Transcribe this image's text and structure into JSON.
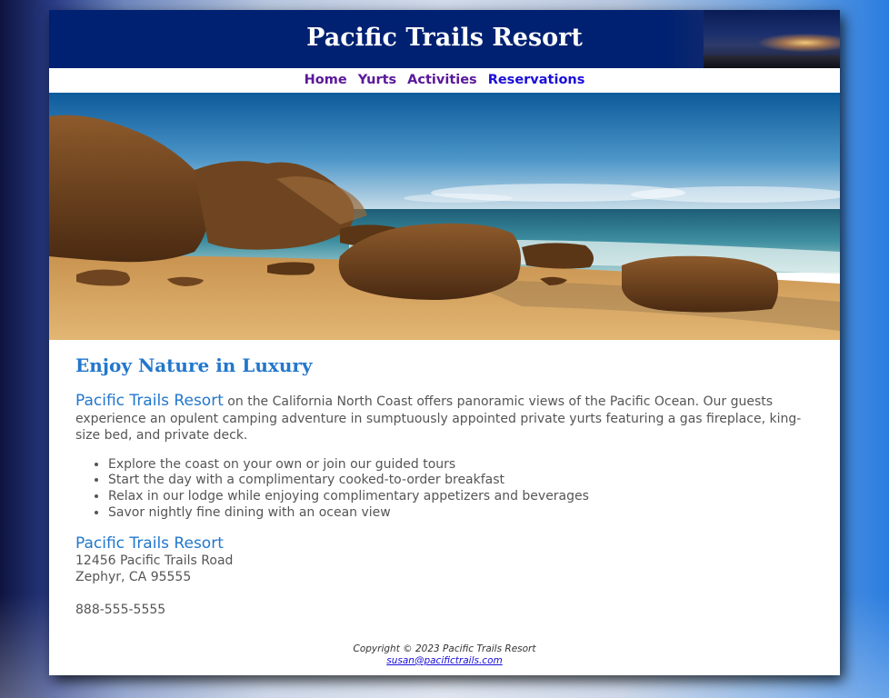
{
  "header": {
    "title": "Pacific Trails Resort"
  },
  "nav": {
    "items": [
      {
        "label": "Home"
      },
      {
        "label": "Yurts"
      },
      {
        "label": "Activities"
      },
      {
        "label": "Reservations"
      }
    ]
  },
  "main": {
    "heading": "Enjoy Nature in Luxury",
    "intro_brand": "Pacific Trails Resort",
    "intro_text": " on the California North Coast offers panoramic views of the Pacific Ocean. Our guests experience an opulent camping adventure in sumptuously appointed private yurts featuring a gas fireplace, king-size bed, and private deck.",
    "features": [
      "Explore the coast on your own or join our guided tours",
      "Start the day with a complimentary cooked-to-order breakfast",
      "Relax in our lodge while enjoying complimentary appetizers and beverages",
      "Savor nightly fine dining with an ocean view"
    ],
    "contact": {
      "name": "Pacific Trails Resort",
      "street": "12456 Pacific Trails Road",
      "city": "Zephyr, CA 95555",
      "phone": "888-555-5555"
    }
  },
  "footer": {
    "copyright": "Copyright © 2023 Pacific Trails Resort",
    "email": "susan@pacifictrails.com"
  },
  "colors": {
    "header_bg": "#002171",
    "accent_blue": "#2277cc",
    "nav_visited": "#5a189a",
    "nav_link": "#1a0ed8",
    "body_text": "#555555"
  }
}
